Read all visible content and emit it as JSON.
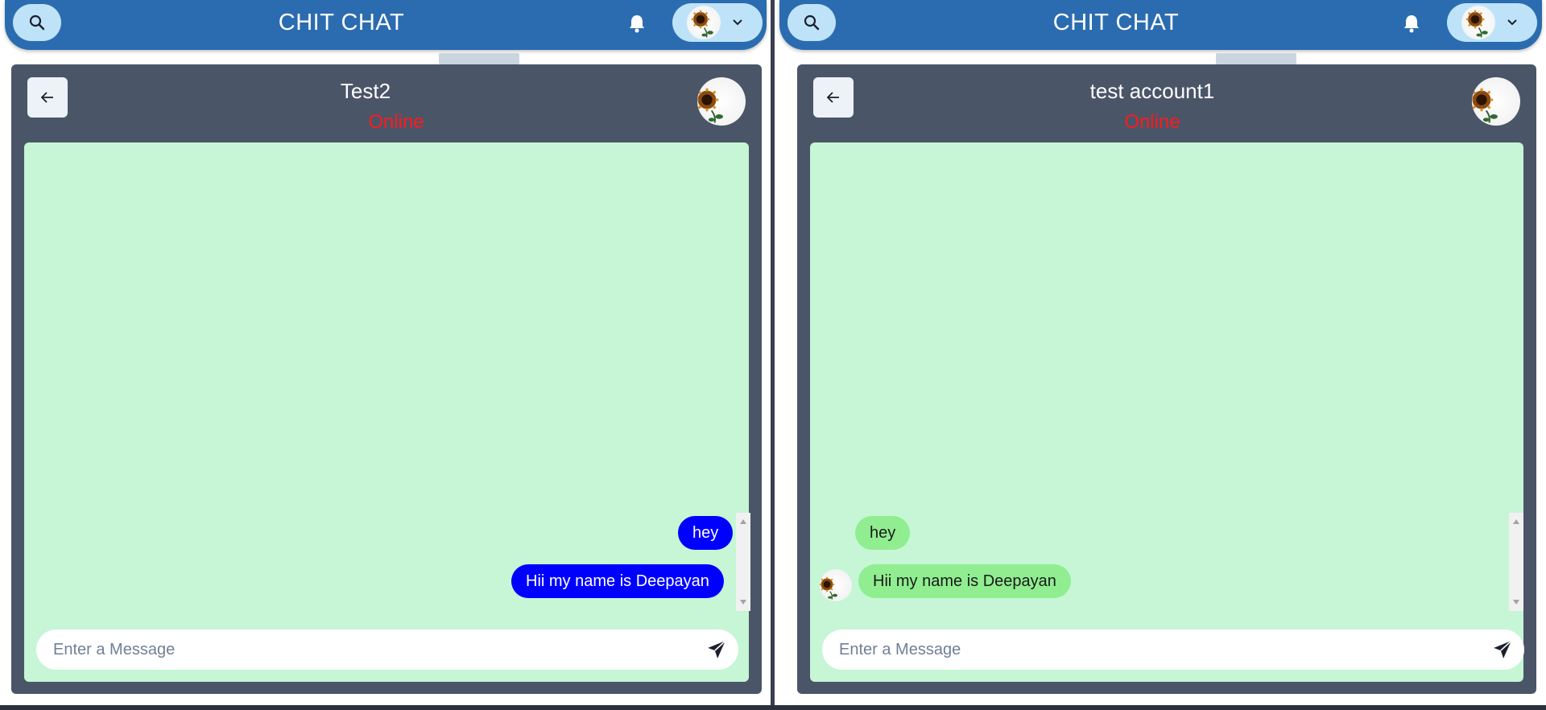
{
  "app": {
    "title": "CHIT CHAT"
  },
  "left": {
    "chat": {
      "name": "Test2",
      "status": "Online"
    },
    "messages": [
      {
        "text": "hey",
        "direction": "sent"
      },
      {
        "text": "Hii my name is Deepayan",
        "direction": "sent"
      }
    ],
    "composer": {
      "placeholder": "Enter a Message",
      "value": ""
    }
  },
  "right": {
    "chat": {
      "name": "test account1",
      "status": "Online"
    },
    "messages": [
      {
        "text": "hey",
        "direction": "received"
      },
      {
        "text": "Hii my name is Deepayan",
        "direction": "received"
      }
    ],
    "composer": {
      "placeholder": "Enter a Message",
      "value": ""
    }
  },
  "colors": {
    "topbar": "#2b6cb0",
    "card": "#4a5568",
    "messages_bg": "#c6f6d5",
    "sent_bubble": "#0000ff",
    "received_bubble": "#90ee90",
    "status": "#ff1a1a"
  },
  "icons": {
    "search": "search-icon",
    "bell": "bell-icon",
    "chevron": "chevron-down-icon",
    "back": "arrow-left-icon",
    "send": "send-icon",
    "avatar": "sunflower-avatar"
  }
}
